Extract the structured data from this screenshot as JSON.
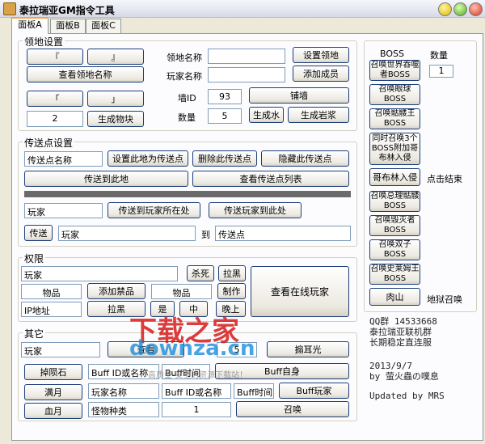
{
  "window": {
    "title": "泰拉瑞亚GM指令工具"
  },
  "tabs": [
    "面板A",
    "面板B",
    "面板C"
  ],
  "territory": {
    "title": "领地设置",
    "btn_left": "『",
    "btn_right": "』",
    "view_names": "查看领地名称",
    "btn_corner_l": "「",
    "btn_corner_r": "」",
    "count_value": "2",
    "gen_block": "生成物块",
    "name_label": "领地名称",
    "name_value": "",
    "player_label": "玩家名称",
    "player_value": "",
    "set_territory": "设置领地",
    "add_member": "添加成员",
    "wall_label": "墙ID",
    "wall_value": "93",
    "lay_wall": "铺墙",
    "qty_label": "数量",
    "qty_value": "5",
    "gen_water": "生成水",
    "gen_lava": "生成岩浆"
  },
  "teleport": {
    "title": "传送点设置",
    "point_name": "传送点名称",
    "set_here": "设置此地为传送点",
    "delete": "删除此传送点",
    "hide": "隐藏此传送点",
    "teleport_here": "传送到此地",
    "view_list": "查看传送点列表",
    "player_field": "玩家",
    "to_player": "传送到玩家所在处",
    "player_to_here": "传送玩家到此处",
    "teleport_btn": "传送",
    "player_field2": "玩家",
    "to_label": "到",
    "point_field": "传送点"
  },
  "permissions": {
    "title": "权限",
    "player_field": "玩家",
    "kill": "杀死",
    "blacklist": "拉黑",
    "item_field": "物品",
    "add_banned": "添加禁品",
    "item_field2": "物品",
    "craft": "制作",
    "ip_field": "IP地址",
    "ip_blacklist": "拉黑",
    "btn_x1": "是",
    "btn_x2": "中",
    "view_online": "查看在线玩家",
    "btn_night": "晚上"
  },
  "others": {
    "title": "其它",
    "player_field": "玩家",
    "view_items": "查看",
    "value_field": "5",
    "slap": "搧耳光",
    "meteor": "掉陨石",
    "full_moon": "满月",
    "blood_moon": "血月",
    "buff_id_field": "Buff ID或名称",
    "buff_time_field": "Buff时间",
    "buff_self": "Buff自身",
    "player_name_field": "玩家名称",
    "buff_id_field2": "Buff ID或名称",
    "buff_time_field2": "Buff时间",
    "buff_player": "Buff玩家",
    "monster_type": "怪物种类",
    "monster_qty": "1",
    "summon": "召唤"
  },
  "boss": {
    "header": "BOSS",
    "qty_label": "数量",
    "qty_value": "1",
    "buttons": [
      "召唤世界吞噬者BOSS",
      "召唤眼球BOSS",
      "召唤骷髅王BOSS",
      "同时召唤3个BOSS附加哥布林入侵",
      "哥布林入侵",
      "召唤总理骷髅BOSS",
      "召唤毁灭者BOSS",
      "召唤双子BOSS",
      "召唤史莱姆王BOSS",
      "肉山"
    ],
    "click_end": "点击结束",
    "hell_summon": "地狱召唤"
  },
  "info": {
    "qq_group": "QQ群 14533668",
    "line2": "泰拉瑞亚联机群",
    "line3": "长期稳定直连服",
    "date": "2013/9/7",
    "by": "by 萤火蟲の噗息",
    "updated": "Updated by MRS"
  },
  "watermark": {
    "cn": "下载之家",
    "en": "downza.cn",
    "sub": "高质量·安全的资源下载站！"
  }
}
